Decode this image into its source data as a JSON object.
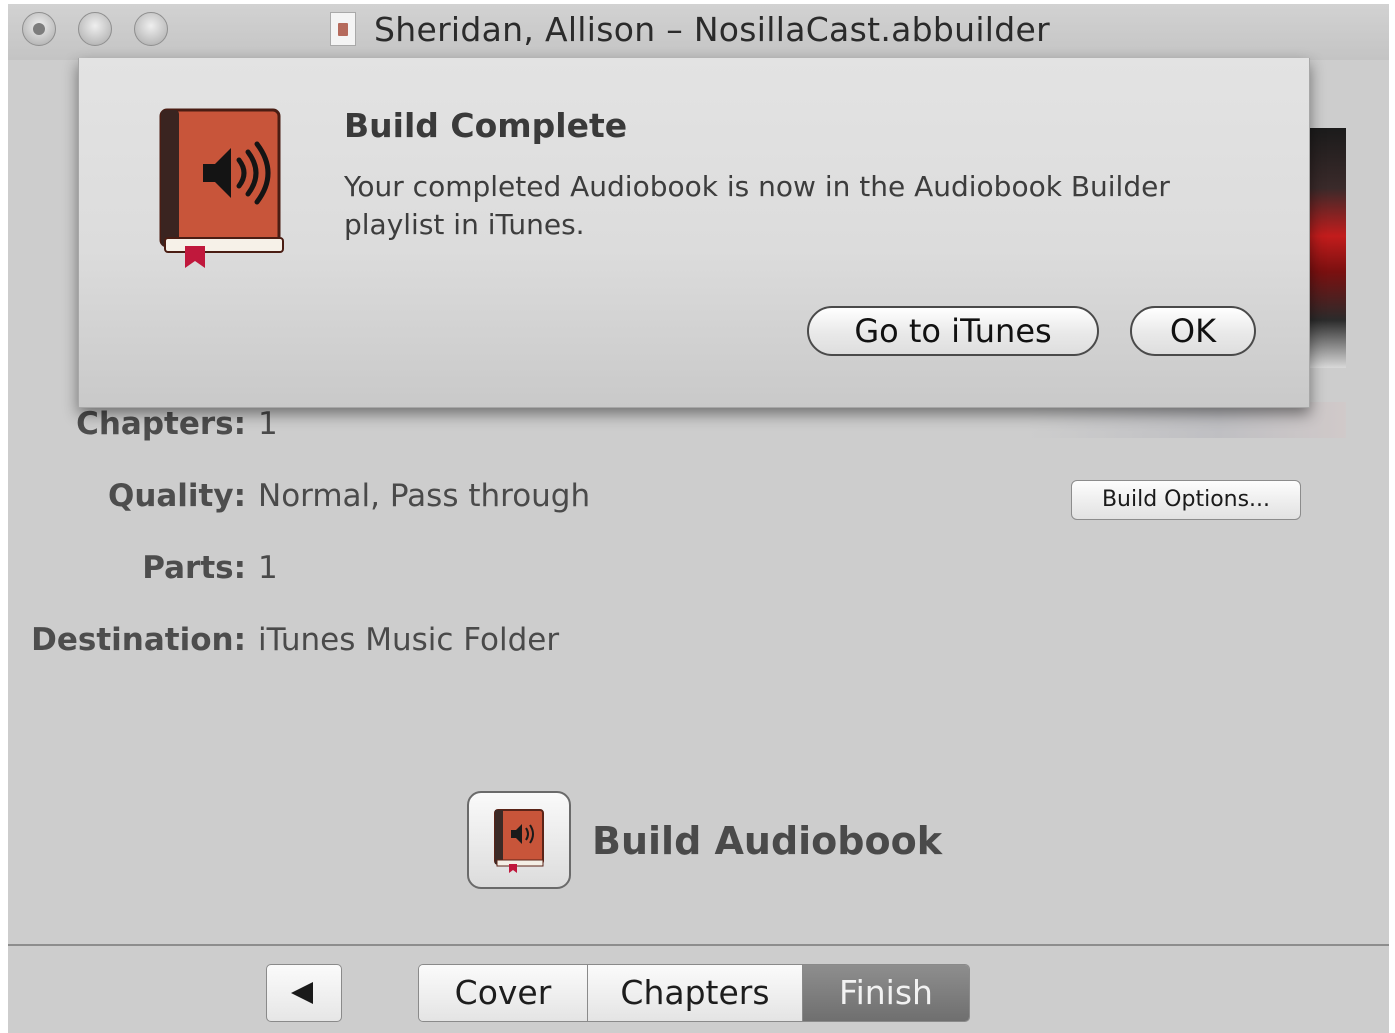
{
  "window": {
    "title": "Sheridan, Allison – NosillaCast.abbuilder"
  },
  "dialog": {
    "title": "Build Complete",
    "message": "Your completed Audiobook is now in the Audiobook Builder playlist in iTunes.",
    "buttons": {
      "go_to_itunes": "Go to iTunes",
      "ok": "OK"
    },
    "icon": "audiobook-builder-icon"
  },
  "info": {
    "chapters": {
      "label": "Chapters:",
      "value": "1"
    },
    "quality": {
      "label": "Quality:",
      "value": "Normal, Pass through"
    },
    "parts": {
      "label": "Parts:",
      "value": "1"
    },
    "destination": {
      "label": "Destination:",
      "value": "iTunes Music Folder"
    }
  },
  "build_options_label": "Build Options...",
  "build": {
    "label": "Build Audiobook",
    "icon": "audiobook-builder-icon"
  },
  "navigation": {
    "back_icon": "back-arrow-icon",
    "tabs": [
      {
        "label": "Cover",
        "selected": false
      },
      {
        "label": "Chapters",
        "selected": false
      },
      {
        "label": "Finish",
        "selected": true
      }
    ]
  },
  "colors": {
    "window_bg": "#cdcdcd",
    "book_cover": "#c8553a",
    "bookmark": "#c0183c",
    "selected_tab": "#7d7d7d"
  }
}
